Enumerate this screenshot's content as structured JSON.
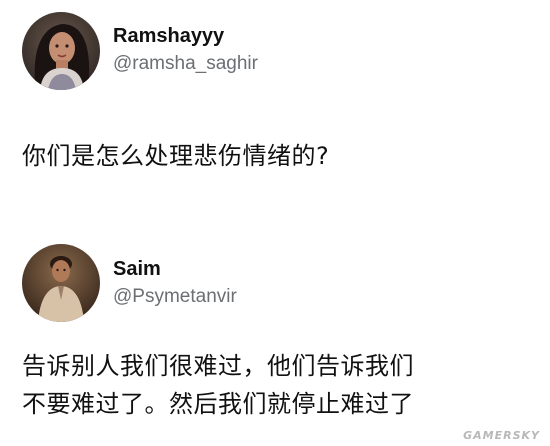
{
  "posts": [
    {
      "display_name": "Ramshayyy",
      "handle": "@ramsha_saghir",
      "text_lines": [
        "你们是怎么处理悲伤情绪的?"
      ]
    },
    {
      "display_name": "Saim",
      "handle": "@Psymetanvir",
      "text_lines": [
        "告诉别人我们很难过，他们告诉我们",
        "不要难过了。然后我们就停止难过了"
      ]
    }
  ],
  "watermark": "GAMERSKY"
}
